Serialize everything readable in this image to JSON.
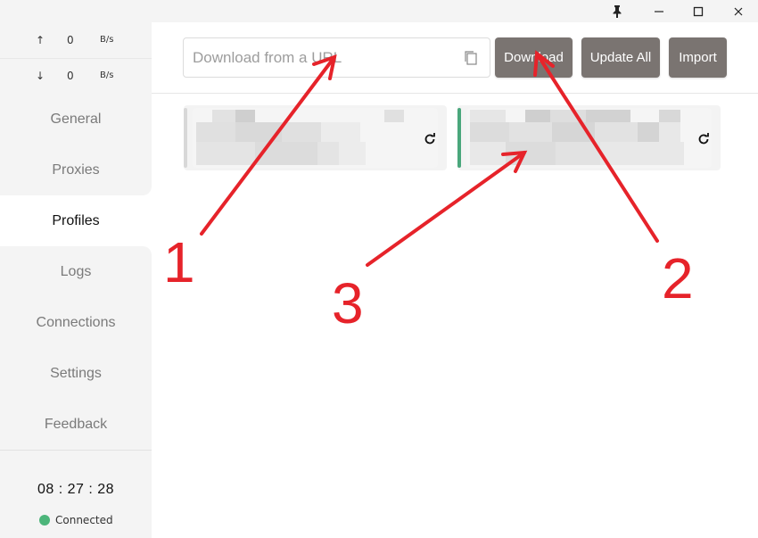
{
  "titlebar": {
    "pin_icon": "pin-icon",
    "minimize_icon": "minimize-icon",
    "maximize_icon": "maximize-icon",
    "close_icon": "close-icon"
  },
  "traffic": {
    "up_arrow": "↑",
    "up_value": "0",
    "up_unit": "B/s",
    "down_arrow": "↓",
    "down_value": "0",
    "down_unit": "B/s"
  },
  "nav": {
    "items": [
      {
        "label": "General"
      },
      {
        "label": "Proxies"
      },
      {
        "label": "Profiles",
        "active": true
      },
      {
        "label": "Logs"
      },
      {
        "label": "Connections"
      },
      {
        "label": "Settings"
      },
      {
        "label": "Feedback"
      }
    ]
  },
  "footer": {
    "clock": "08 : 27 : 28",
    "status": "Connected",
    "status_color": "#4cb57a"
  },
  "header": {
    "url_placeholder": "Download from a URL",
    "download_label": "Download",
    "update_all_label": "Update All",
    "import_label": "Import"
  },
  "profiles": [
    {
      "selected": false,
      "bar_color": "#d8d8d8"
    },
    {
      "selected": true,
      "bar_color": "#4aa77c"
    }
  ],
  "annotations": {
    "color": "#e6232a",
    "labels": [
      "1",
      "2",
      "3"
    ]
  }
}
